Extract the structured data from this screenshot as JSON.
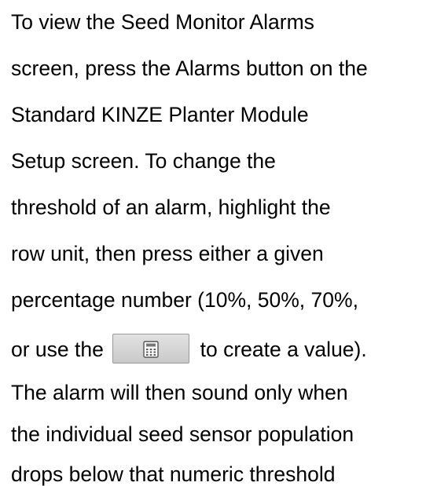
{
  "paragraph": {
    "lines": [
      "To view the Seed Monitor Alarms",
      "screen, press the Alarms button on the",
      "Standard KINZE Planter Module",
      "Setup screen. To change the",
      "threshold of an alarm, highlight the",
      "row unit, then press either a given",
      "percentage number (10%, 50%, 70%,",
      "or use the",
      "to create a value).",
      "The alarm will then sound only when",
      "the individual seed sensor population",
      "drops below that numeric threshold"
    ]
  },
  "inline_button": {
    "icon": "calculator-icon"
  },
  "colors": {
    "text": "#000000",
    "background": "#ffffff",
    "button_face": "#d6d6d6",
    "button_border": "#9a9a9a"
  }
}
